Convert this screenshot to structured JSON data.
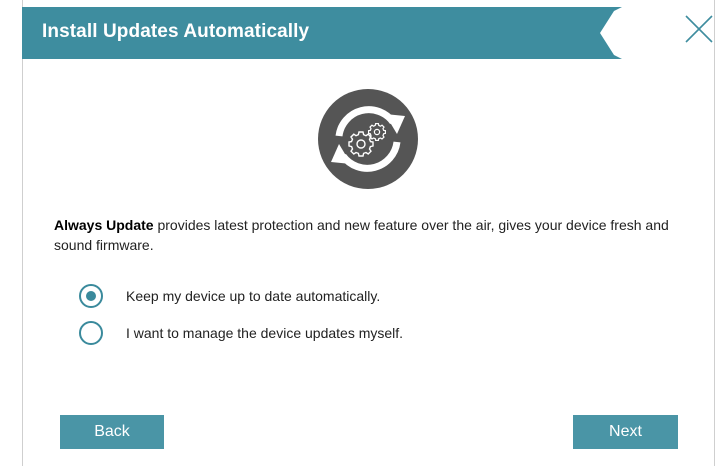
{
  "dialog": {
    "title": "Install Updates Automatically",
    "description_bold": "Always Update",
    "description_rest": " provides latest protection and new feature over the air, gives your device fresh and sound firmware.",
    "options": [
      {
        "label": "Keep my device up to date automatically.",
        "selected": true
      },
      {
        "label": "I want to manage the device updates myself.",
        "selected": false
      }
    ],
    "back_label": "Back",
    "next_label": "Next"
  },
  "colors": {
    "header": "#3e8d9f",
    "accent": "#3a8a9c",
    "button": "#4a95a6",
    "icon_bg": "#555555"
  },
  "icons": {
    "close": "close-icon",
    "update": "update-gears-icon"
  }
}
